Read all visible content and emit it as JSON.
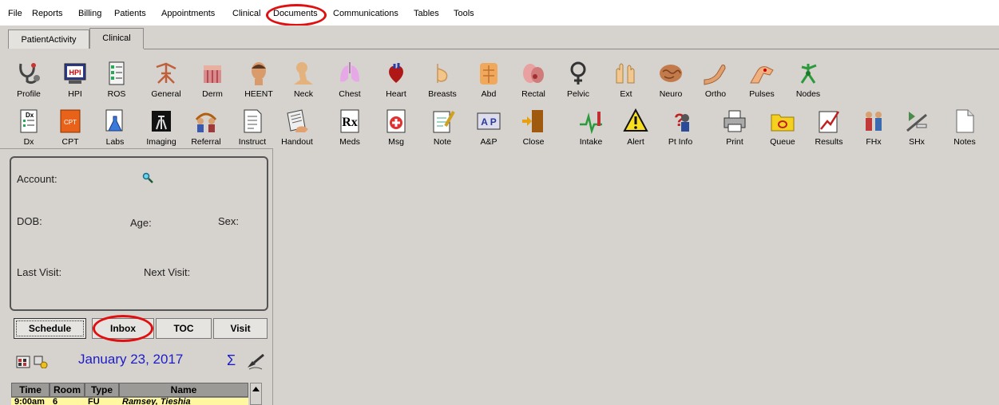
{
  "menu": [
    "File",
    "Reports",
    "Billing",
    "Patients",
    "Appointments",
    "Clinical",
    "Documents",
    "Communications",
    "Tables",
    "Tools"
  ],
  "tabs": [
    "PatientActivity",
    "Clinical"
  ],
  "toolbar_row1": [
    {
      "label": "Profile",
      "icon": "stethoscope-icon"
    },
    {
      "label": "HPI",
      "icon": "hpi-computer-icon"
    },
    {
      "label": "ROS",
      "icon": "checklist-icon"
    },
    {
      "label": "General",
      "icon": "body-outline-icon"
    },
    {
      "label": "Derm",
      "icon": "skin-icon"
    },
    {
      "label": "HEENT",
      "icon": "head-icon"
    },
    {
      "label": "Neck",
      "icon": "neck-icon"
    },
    {
      "label": "Chest",
      "icon": "lungs-icon"
    },
    {
      "label": "Heart",
      "icon": "heart-icon"
    },
    {
      "label": "Breasts",
      "icon": "breast-icon"
    },
    {
      "label": "Abd",
      "icon": "abdomen-icon"
    },
    {
      "label": "Rectal",
      "icon": "rectal-icon"
    },
    {
      "label": "Pelvic",
      "icon": "female-symbol-icon"
    },
    {
      "label": "Ext",
      "icon": "hands-icon"
    },
    {
      "label": "Neuro",
      "icon": "brain-icon"
    },
    {
      "label": "Ortho",
      "icon": "arm-icon"
    },
    {
      "label": "Pulses",
      "icon": "pulse-limb-icon"
    },
    {
      "label": "Nodes",
      "icon": "lymph-nodes-icon"
    }
  ],
  "toolbar_row2": [
    {
      "label": "Dx",
      "icon": "diagnosis-icon"
    },
    {
      "label": "CPT",
      "icon": "cpt-book-icon"
    },
    {
      "label": "Labs",
      "icon": "lab-flask-icon"
    },
    {
      "label": "Imaging",
      "icon": "xray-icon"
    },
    {
      "label": "Referral",
      "icon": "referral-people-icon"
    },
    {
      "label": "Instruct",
      "icon": "instructions-icon"
    },
    {
      "label": "Handout",
      "icon": "handout-icon"
    },
    {
      "label": "Meds",
      "icon": "rx-icon"
    },
    {
      "label": "Msg",
      "icon": "message-icon"
    },
    {
      "label": "Note",
      "icon": "note-pen-icon"
    },
    {
      "label": "A&P",
      "icon": "assessment-plan-icon"
    },
    {
      "label": "Close",
      "icon": "exit-door-icon"
    },
    {
      "label": "Intake",
      "icon": "intake-vitals-icon"
    },
    {
      "label": "Alert",
      "icon": "warning-triangle-icon"
    },
    {
      "label": "Pt Info",
      "icon": "patient-info-icon"
    },
    {
      "label": "Print",
      "icon": "printer-icon"
    },
    {
      "label": "Queue",
      "icon": "queue-folder-icon"
    },
    {
      "label": "Results",
      "icon": "results-chart-icon"
    },
    {
      "label": "FHx",
      "icon": "family-history-icon"
    },
    {
      "label": "SHx",
      "icon": "social-history-icon"
    },
    {
      "label": "Notes",
      "icon": "blank-page-icon"
    }
  ],
  "patient": {
    "account": "Account:",
    "dob": "DOB:",
    "age": "Age:",
    "sex": "Sex:",
    "last_visit": "Last Visit:",
    "next_visit": "Next Visit:"
  },
  "bottom_tabs": [
    "Schedule",
    "Inbox",
    "TOC",
    "Visit"
  ],
  "schedule": {
    "date": "January 23, 2017",
    "sigma": "Σ",
    "columns": [
      "Time",
      "Room",
      "Type",
      "Name"
    ],
    "first_row": [
      "9:00am",
      "6",
      "FU",
      "Ramsey, Tieshia"
    ]
  },
  "colors": {
    "annotation": "#e01010",
    "date": "#1c1cc8",
    "row_highlight": "#fff8a0"
  }
}
